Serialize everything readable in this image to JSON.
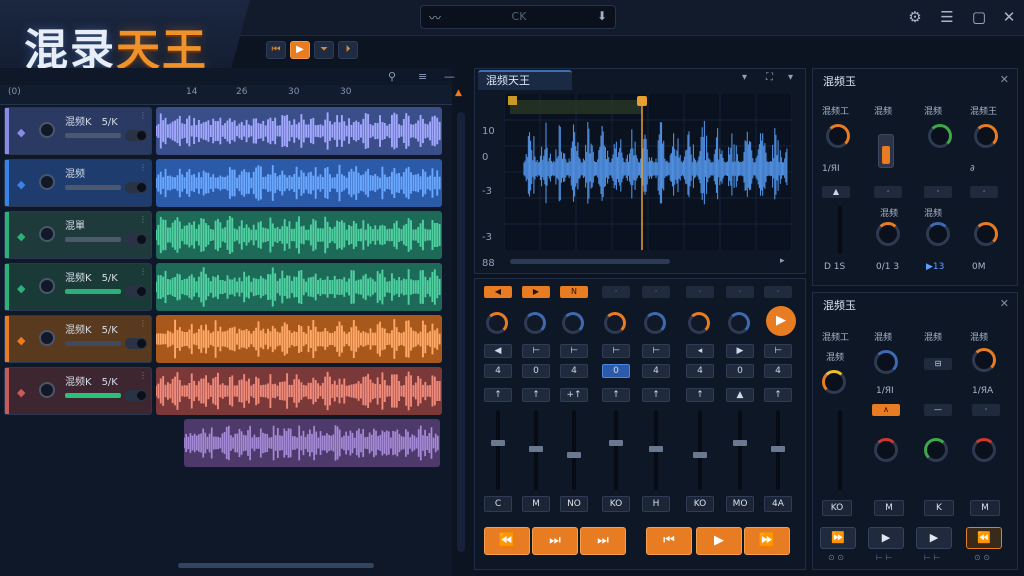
{
  "app": {
    "title_part1": "混录",
    "title_part2": "天王"
  },
  "search": {
    "value": "CK"
  },
  "window_controls": [
    "settings-icon",
    "minimize-icon",
    "maximize-icon",
    "close-icon"
  ],
  "transport_mini": [
    {
      "glyph": "⏮",
      "active": false
    },
    {
      "glyph": "▶",
      "active": true
    },
    {
      "glyph": "⏷",
      "active": false
    },
    {
      "glyph": "⏵",
      "active": false
    }
  ],
  "timeline": {
    "start_label": "(0)",
    "ticks": [
      "14",
      "26",
      "30",
      "30"
    ]
  },
  "tracks": [
    {
      "name": "混频K",
      "tag": "5/K",
      "color": "#8b8be6",
      "head": "#2a3a62",
      "clip": "#3a4f8a",
      "wave": "#a3a8ff"
    },
    {
      "name": "混频",
      "tag": "",
      "color": "#3a82e8",
      "head": "#1e3c6e",
      "clip": "#2a5aa8",
      "wave": "#6aa7ff"
    },
    {
      "name": "混單",
      "tag": "",
      "color": "#2ab078",
      "head": "#1e3a3a",
      "clip": "#1e6a58",
      "wave": "#4fd0a0"
    },
    {
      "name": "混频K",
      "tag": "5/K",
      "color": "#2ab078",
      "head": "#1a3a38",
      "clip": "#1e6a58",
      "wave": "#4fd0a0"
    },
    {
      "name": "混频K",
      "tag": "5/K",
      "color": "#e87c22",
      "head": "#5a3a1e",
      "clip": "#a8581a",
      "wave": "#ffa868"
    },
    {
      "name": "混频K",
      "tag": "5/K",
      "color": "#c85a5a",
      "head": "#3e2630",
      "clip": "#7a3838",
      "wave": "#f08a7a"
    },
    {
      "name": "",
      "tag": "",
      "color": "#9a6ac0",
      "head": "",
      "clip": "#4e3a6a",
      "wave": "#a68ad8"
    }
  ],
  "editor": {
    "tab": "混频天王",
    "y_labels": [
      "10",
      "0",
      "-3",
      "-3",
      "88"
    ]
  },
  "mixer": {
    "top_buttons": [
      "◀",
      "▶",
      "N",
      "·",
      "·",
      "·",
      "·",
      "·"
    ],
    "step_top": [
      "◀",
      "⊢",
      "⊢",
      "⊢",
      "⊢",
      "◂",
      "▶",
      "⊢"
    ],
    "step_mid": [
      "4",
      "0",
      "4",
      "0",
      "4",
      "4",
      "0",
      "4"
    ],
    "step_bot": [
      "↑",
      "↑",
      "+↑",
      "↑",
      "↑",
      "↑",
      "▲",
      "↑"
    ],
    "labels": [
      "C",
      "M",
      "NO",
      "KO",
      "H",
      "KO",
      "MO",
      "4A"
    ],
    "transport": [
      "⏪",
      "⏭",
      "⏭",
      "⏮",
      "▶",
      "⏩"
    ]
  },
  "panel1": {
    "title": "混频玉",
    "headers": [
      "混频工",
      "混频",
      "混频",
      "混频王"
    ],
    "mid_labels": [
      "1/ЯI",
      "",
      "",
      "∂"
    ],
    "bottom_labels": [
      "D 1S",
      "0/1 3",
      "▶13",
      "0M"
    ],
    "accent": "#e87c22"
  },
  "panel2": {
    "title": "混频玉",
    "headers": [
      "混频工",
      "混频",
      "混频",
      "混频"
    ],
    "sub_labels": [
      "混频",
      "1/ЯI",
      "",
      "1/ЯA"
    ],
    "labels": [
      "KO",
      "M",
      "K",
      "M"
    ],
    "transport": [
      "⏩",
      "▶",
      "▶",
      "⏪"
    ],
    "transport_tags": [
      "⊙ ⊙",
      "⊢ ⊢",
      "⊢ ⊢",
      "⊙ ⊙"
    ]
  }
}
